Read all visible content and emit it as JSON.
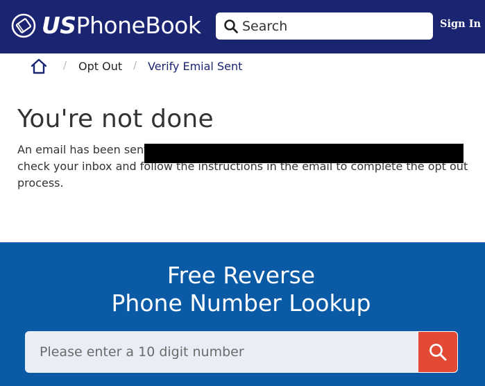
{
  "header": {
    "logo": {
      "us": "US",
      "rest": "PhoneBook",
      "icon": "phonebook-logo-icon"
    },
    "search": {
      "placeholder": "Search",
      "icon": "search-icon"
    },
    "signin_label": "Sign In",
    "background": "#1a2470"
  },
  "breadcrumb": {
    "home_icon": "home-icon",
    "separator": "/",
    "items": [
      {
        "label": "Opt Out"
      },
      {
        "label": "Verify Emial Sent"
      }
    ]
  },
  "main": {
    "title": "You're not done",
    "message_lines": [
      "An email has been sent to                                                                        Please",
      "check your inbox and follow the instructions in the email to complete the opt out",
      "process."
    ]
  },
  "lookup": {
    "title_line1": "Free Reverse",
    "title_line2": "Phone Number Lookup",
    "input_placeholder": "Please enter a 10 digit number",
    "button_icon": "search-icon",
    "background": "#0b5aa5",
    "button_color": "#e24a35"
  }
}
